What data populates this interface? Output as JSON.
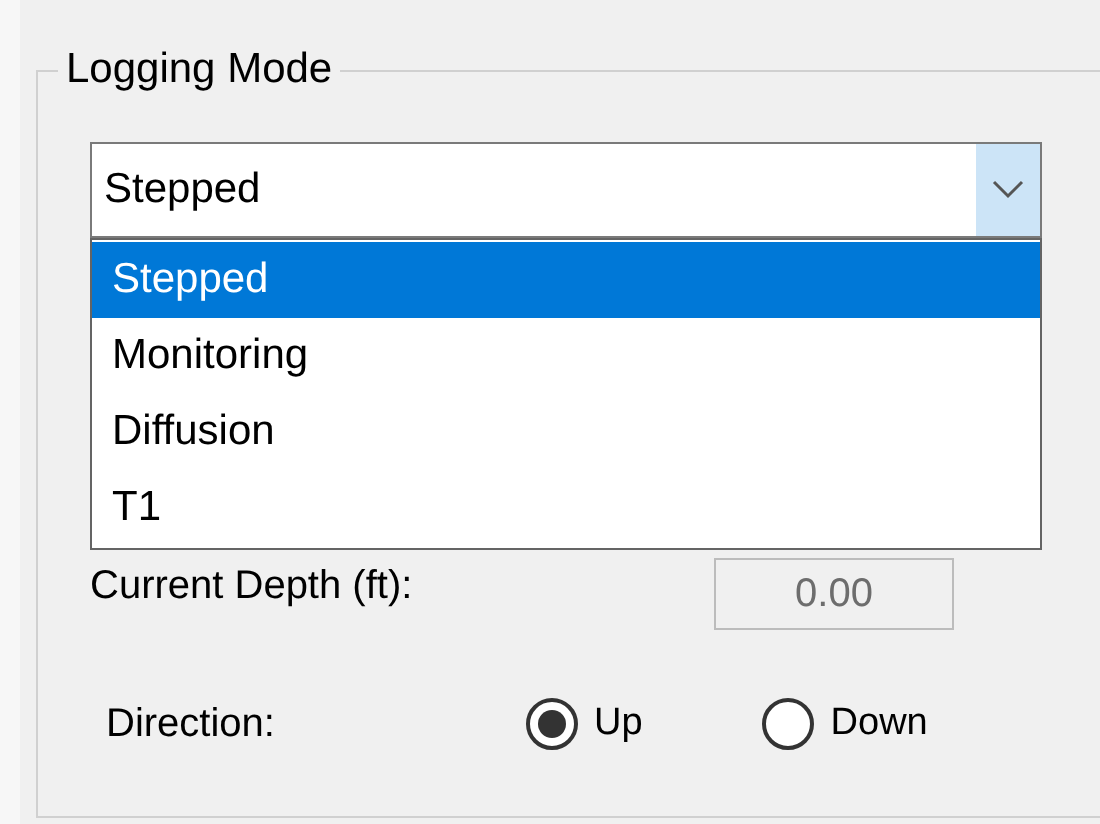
{
  "group": {
    "title": "Logging Mode"
  },
  "mode_combo": {
    "value": "Stepped",
    "expanded": true
  },
  "mode_options": [
    {
      "label": "Stepped",
      "selected": true
    },
    {
      "label": "Monitoring",
      "selected": false
    },
    {
      "label": "Diffusion",
      "selected": false
    },
    {
      "label": "T1",
      "selected": false
    }
  ],
  "current_depth": {
    "label": "Current Depth (ft):",
    "value": "0.00",
    "disabled": true
  },
  "direction": {
    "label": "Direction:",
    "options": [
      {
        "label": "Up",
        "selected": true
      },
      {
        "label": "Down",
        "selected": false
      }
    ]
  }
}
